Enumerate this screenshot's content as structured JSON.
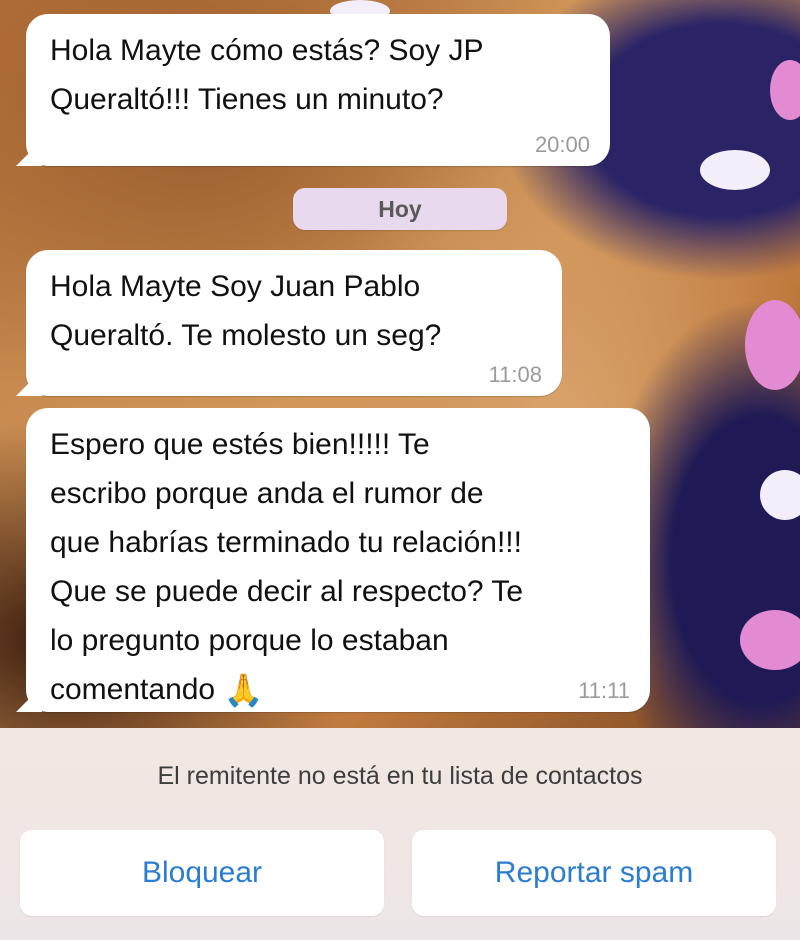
{
  "chat": {
    "messages": [
      {
        "text": "Hola Mayte cómo estás? Soy JP\nQueraltó!!! Tienes un minuto?",
        "time": "20:00"
      },
      {
        "text": "Hola Mayte Soy Juan Pablo\nQueraltó. Te molesto un seg?",
        "time": "11:08"
      },
      {
        "text": "Espero que estés bien!!!!! Te\nescribo porque anda el rumor de\nque habrías terminado tu relación!!!\nQue se puede decir al respecto?  Te\nlo pregunto porque lo estaban\ncomentando ",
        "emoji": "🙏",
        "time": "11:11"
      }
    ],
    "day_separator": "Hoy"
  },
  "unknown_sender": {
    "notice": "El remitente no está en tu lista de contactos",
    "block_label": "Bloquear",
    "report_label": "Reportar spam"
  },
  "colors": {
    "accent_blue": "#2a7dd0",
    "bubble_bg": "#ffffff",
    "timestamp_gray": "#9b9b9b"
  }
}
